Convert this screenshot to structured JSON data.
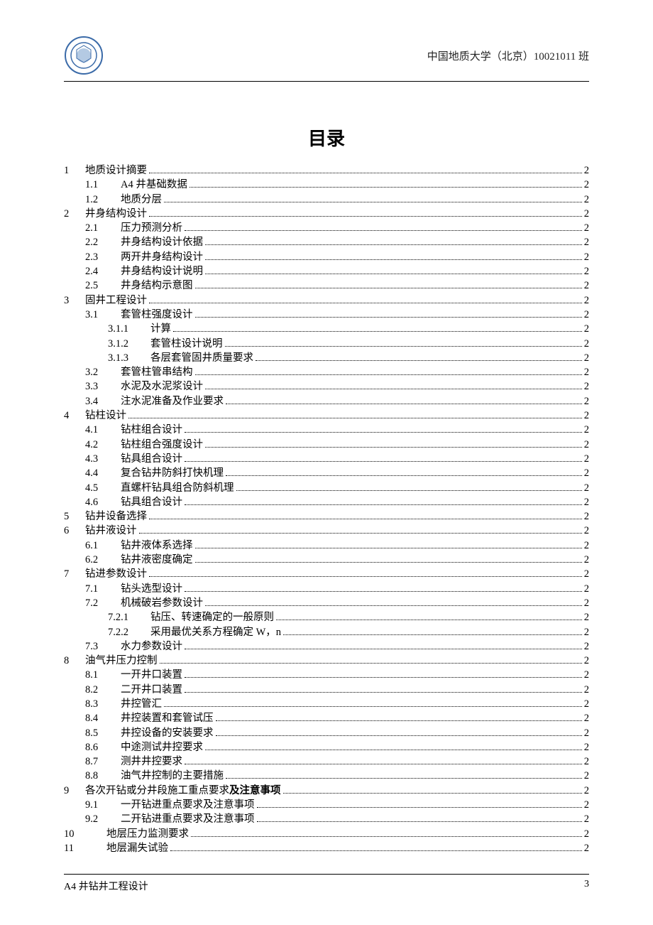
{
  "header": {
    "institution": "中国地质大学（北京）10021011 班"
  },
  "title": "目录",
  "toc": [
    {
      "lvl": 0,
      "num": "1",
      "text": "地质设计摘要",
      "page": "2"
    },
    {
      "lvl": 1,
      "num": "1.1",
      "text": "A4 井基础数据",
      "page": "2"
    },
    {
      "lvl": 1,
      "num": "1.2",
      "text": "地质分层",
      "page": "2"
    },
    {
      "lvl": 0,
      "num": "2",
      "text": "井身结构设计",
      "page": "2"
    },
    {
      "lvl": 1,
      "num": "2.1",
      "text": "压力预测分析",
      "page": "2"
    },
    {
      "lvl": 1,
      "num": "2.2",
      "text": "井身结构设计依据",
      "page": "2"
    },
    {
      "lvl": 1,
      "num": "2.3",
      "text": "两开井身结构设计",
      "page": "2"
    },
    {
      "lvl": 1,
      "num": "2.4",
      "text": "井身结构设计说明",
      "page": "2"
    },
    {
      "lvl": 1,
      "num": "2.5",
      "text": "井身结构示意图",
      "page": "2"
    },
    {
      "lvl": 0,
      "num": "3",
      "text": "固井工程设计",
      "page": "2"
    },
    {
      "lvl": 1,
      "num": "3.1",
      "text": "套管柱强度设计",
      "page": "2"
    },
    {
      "lvl": 2,
      "num": "3.1.1",
      "text": "计算",
      "page": "2"
    },
    {
      "lvl": 2,
      "num": "3.1.2",
      "text": "套管柱设计说明",
      "page": "2"
    },
    {
      "lvl": 2,
      "num": "3.1.3",
      "text": "各层套管固井质量要求",
      "page": "2"
    },
    {
      "lvl": 1,
      "num": "3.2",
      "text": "套管柱管串结构",
      "page": "2"
    },
    {
      "lvl": 1,
      "num": "3.3",
      "text": "水泥及水泥浆设计",
      "page": "2"
    },
    {
      "lvl": 1,
      "num": "3.4",
      "text": "注水泥准备及作业要求",
      "page": "2"
    },
    {
      "lvl": 0,
      "num": "4",
      "text": "钻柱设计",
      "page": "2"
    },
    {
      "lvl": 1,
      "num": "4.1",
      "text": "钻柱组合设计",
      "page": "2"
    },
    {
      "lvl": 1,
      "num": "4.2",
      "text": "钻柱组合强度设计",
      "page": "2"
    },
    {
      "lvl": 1,
      "num": "4.3",
      "text": "钻具组合设计",
      "page": "2"
    },
    {
      "lvl": 1,
      "num": "4.4",
      "text": "复合钻井防斜打快机理",
      "page": "2"
    },
    {
      "lvl": 1,
      "num": "4.5",
      "text": "直螺杆钻具组合防斜机理",
      "page": "2"
    },
    {
      "lvl": 1,
      "num": "4.6",
      "text": "钻具组合设计",
      "page": "2"
    },
    {
      "lvl": 0,
      "num": "5",
      "text": "钻井设备选择",
      "page": "2"
    },
    {
      "lvl": 0,
      "num": "6",
      "text": "钻井液设计",
      "page": "2"
    },
    {
      "lvl": 1,
      "num": "6.1",
      "text": "钻井液体系选择",
      "page": "2"
    },
    {
      "lvl": 1,
      "num": "6.2",
      "text": "钻井液密度确定",
      "page": "2"
    },
    {
      "lvl": 0,
      "num": "7",
      "text": "钻进参数设计",
      "page": "2"
    },
    {
      "lvl": 1,
      "num": "7.1",
      "text": "钻头选型设计",
      "page": "2"
    },
    {
      "lvl": 1,
      "num": "7.2",
      "text": "机械破岩参数设计",
      "page": "2"
    },
    {
      "lvl": 2,
      "num": "7.2.1",
      "text": "钻压、转速确定的一般原则",
      "page": "2"
    },
    {
      "lvl": 2,
      "num": "7.2.2",
      "text": "采用最优关系方程确定 W，n",
      "page": "2"
    },
    {
      "lvl": 1,
      "num": "7.3",
      "text": "水力参数设计",
      "page": "2"
    },
    {
      "lvl": 0,
      "num": "8",
      "text": "油气井压力控制",
      "page": "2"
    },
    {
      "lvl": 1,
      "num": "8.1",
      "text": "一开井口装置",
      "page": "2"
    },
    {
      "lvl": 1,
      "num": "8.2",
      "text": "二开井口装置",
      "page": "2"
    },
    {
      "lvl": 1,
      "num": "8.3",
      "text": "井控管汇",
      "page": "2"
    },
    {
      "lvl": 1,
      "num": "8.4",
      "text": "井控装置和套管试压",
      "page": "2"
    },
    {
      "lvl": 1,
      "num": "8.5",
      "text": "井控设备的安装要求",
      "page": "2"
    },
    {
      "lvl": 1,
      "num": "8.6",
      "text": "中途测试井控要求",
      "page": "2"
    },
    {
      "lvl": 1,
      "num": "8.7",
      "text": "测井井控要求",
      "page": "2"
    },
    {
      "lvl": 1,
      "num": "8.8",
      "text": "油气井控制的主要措施",
      "page": "2"
    },
    {
      "lvl": 0,
      "num": "9",
      "text": "各次开钻或分井段施工重点要求",
      "bold_suffix": "及注意事项",
      "page": "2"
    },
    {
      "lvl": 1,
      "num": "9.1",
      "text": "一开钻进重点要求及注意事项",
      "page": "2"
    },
    {
      "lvl": 1,
      "num": "9.2",
      "text": "二开钻进重点要求及注意事项",
      "page": "2"
    },
    {
      "lvl": 0,
      "num": "10",
      "text": "地层压力监测要求",
      "page": "2",
      "wide": true
    },
    {
      "lvl": 0,
      "num": "11",
      "text": "地层漏失试验",
      "page": "2",
      "wide": true
    }
  ],
  "footer": {
    "left": "A4 井钻井工程设计",
    "right": "3"
  }
}
